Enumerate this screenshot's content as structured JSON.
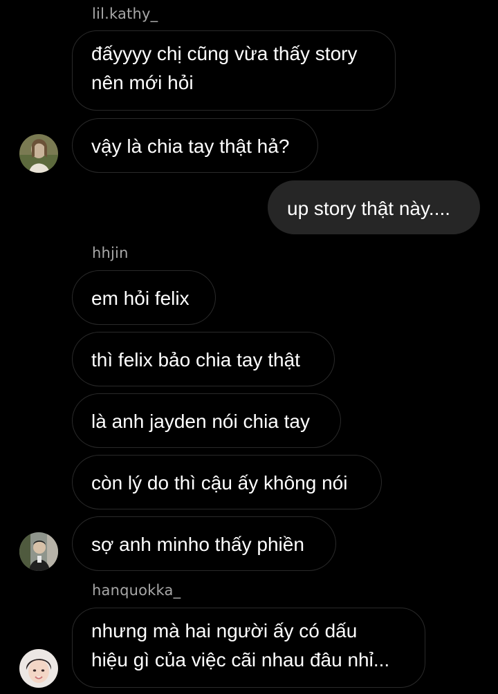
{
  "chat": {
    "groups": [
      {
        "sender": "lil.kathy_",
        "messages": [
          "đấyyyy chị cũng vừa thấy story",
          "nên mới hỏi",
          "vậy là chia tay thật hả?"
        ],
        "avatar_icon": "user-avatar-photo-icon"
      },
      {
        "sender": "me",
        "messages": [
          "up story thật này...."
        ]
      },
      {
        "sender": "hhjin",
        "messages": [
          "em hỏi felix",
          "thì felix bảo chia tay thật",
          "là anh jayden nói chia tay",
          "còn lý do thì cậu ấy không nói",
          "sợ anh minho thấy phiền"
        ],
        "avatar_icon": "user-avatar-photo-icon"
      },
      {
        "sender": "hanquokka_",
        "messages": [
          "nhưng mà hai người ấy có dấu",
          "hiệu gì của việc cãi nhau đâu nhỉ..."
        ],
        "avatar_icon": "user-avatar-photo-icon"
      }
    ]
  },
  "colors": {
    "background": "#000000",
    "bubble_border": "#2a2a2a",
    "my_bubble": "#262626",
    "sender_name": "#a8a8a8",
    "text": "#ffffff"
  }
}
